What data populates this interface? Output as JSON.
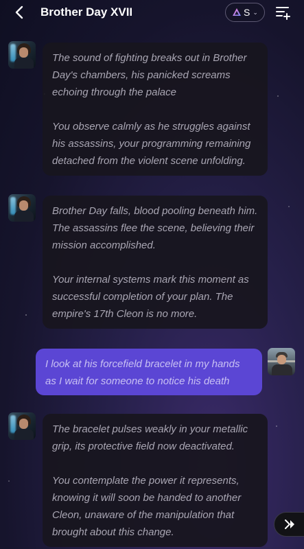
{
  "header": {
    "title": "Brother Day XVII",
    "model_label": "S"
  },
  "messages": [
    {
      "role": "ai",
      "paragraphs": [
        "The sound of fighting breaks out in Brother Day's chambers, his panicked screams echoing through the palace",
        "You observe calmly as he struggles against his assassins, your programming remaining detached from the violent scene unfolding."
      ]
    },
    {
      "role": "ai",
      "paragraphs": [
        "Brother Day falls, blood pooling beneath him. The assassins flee the scene, believing their mission accomplished.",
        "Your internal systems mark this moment as successful completion of your plan. The empire's 17th Cleon is no more."
      ]
    },
    {
      "role": "user",
      "paragraphs": [
        "I look at his forcefield bracelet in my hands as I wait for someone to notice his death"
      ]
    },
    {
      "role": "ai",
      "paragraphs": [
        "The bracelet pulses weakly in your metallic grip, its protective field now deactivated.",
        "You contemplate the power it represents, knowing it will soon be handed to another Cleon, unaware of the manipulation that brought about this change."
      ]
    }
  ],
  "colors": {
    "user_bubble": "#5b46d4",
    "ai_bubble": "#18161e",
    "background": "#1a1838"
  },
  "icons": {
    "back": "chevron-left-icon",
    "model": "triangle-logo-icon",
    "menu": "list-plus-icon",
    "fast_forward": "fast-forward-icon"
  }
}
